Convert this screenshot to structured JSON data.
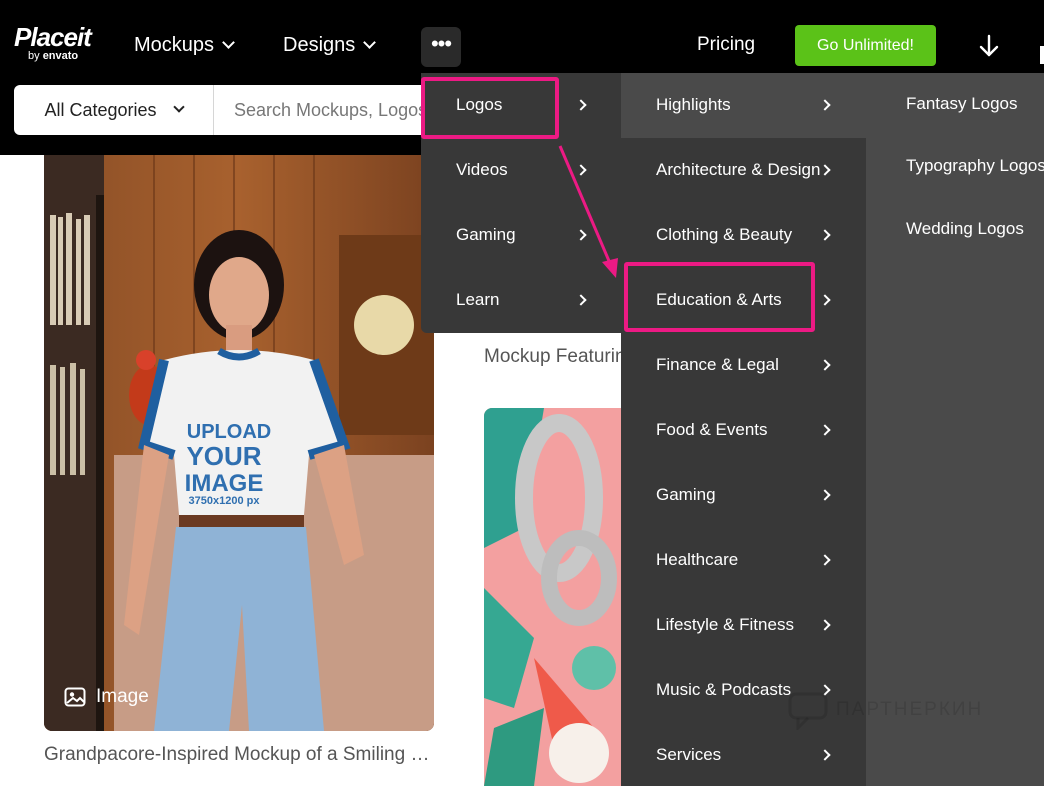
{
  "header": {
    "logo": {
      "name": "Placeit",
      "by": "by",
      "brand": "envato"
    },
    "nav": [
      {
        "label": "Mockups"
      },
      {
        "label": "Designs"
      }
    ],
    "more_label": "•••",
    "pricing": "Pricing",
    "cta": "Go Unlimited!",
    "cta_color": "#5bc218"
  },
  "search": {
    "category": "All Categories",
    "placeholder": "Search Mockups, Logos"
  },
  "cards": [
    {
      "badge": "Image",
      "caption": "Grandpacore-Inspired Mockup of a Smiling …",
      "shirt_text": [
        "UPLOAD",
        "YOUR",
        "IMAGE",
        "3750x1200 px"
      ]
    },
    {
      "caption": "Mockup Featuring"
    }
  ],
  "menu": {
    "level1": [
      {
        "label": "Logos"
      },
      {
        "label": "Videos"
      },
      {
        "label": "Gaming"
      },
      {
        "label": "Learn"
      }
    ],
    "level2": [
      {
        "label": "Highlights"
      },
      {
        "label": "Architecture & Design"
      },
      {
        "label": "Clothing & Beauty"
      },
      {
        "label": "Education & Arts"
      },
      {
        "label": "Finance & Legal"
      },
      {
        "label": "Food & Events"
      },
      {
        "label": "Gaming"
      },
      {
        "label": "Healthcare"
      },
      {
        "label": "Lifestyle & Fitness"
      },
      {
        "label": "Music & Podcasts"
      },
      {
        "label": "Services"
      }
    ],
    "level3": [
      {
        "label": "Fantasy Logos"
      },
      {
        "label": "Typography Logos"
      },
      {
        "label": "Wedding Logos"
      }
    ]
  },
  "annotation_color": "#ec1a84",
  "watermark": "ПАРТНЕРКИН"
}
